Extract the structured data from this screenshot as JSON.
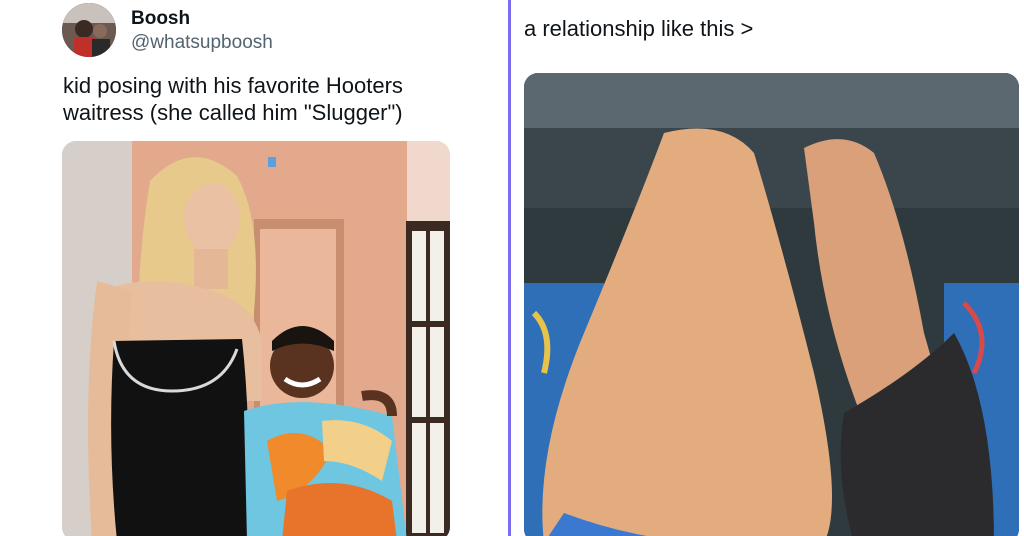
{
  "tweet": {
    "display_name": "Boosh",
    "handle": "@whatsupboosh",
    "text": "kid posing with his favorite Hooters waitress (she called him \"Slugger\")"
  },
  "post": {
    "caption": "a relationship like this >"
  },
  "colors": {
    "divider": "#7b6cf0",
    "handle": "#536471",
    "text": "#0f1419"
  }
}
